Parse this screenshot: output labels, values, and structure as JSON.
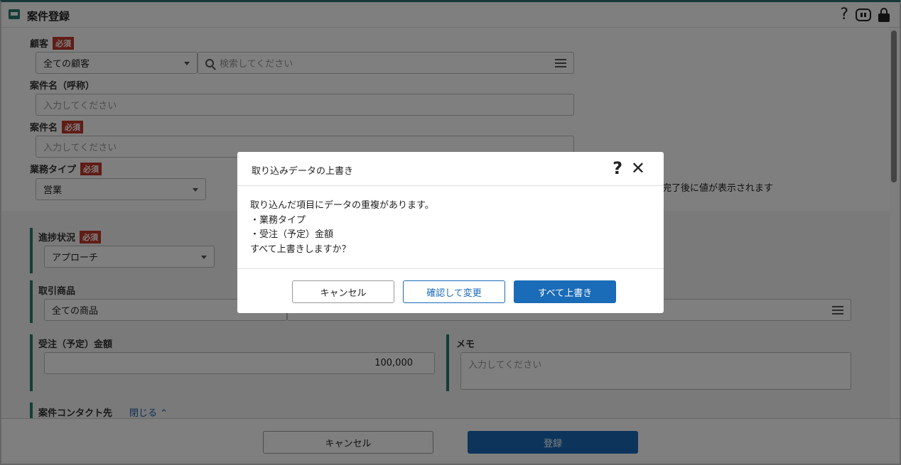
{
  "header": {
    "title": "案件登録"
  },
  "form": {
    "customer_label": "顧客",
    "required_badge": "必須",
    "customer_select": "全ての顧客",
    "customer_search_placeholder": "検索してください",
    "deal_nickname_label": "案件名（呼称）",
    "deal_nickname_placeholder": "入力してください",
    "deal_name_label": "案件名",
    "deal_name_placeholder": "入力してください",
    "business_type_label": "業務タイプ",
    "business_type_value": "営業",
    "hidden_note": "完了後に値が表示されます",
    "progress_label": "進捗状況",
    "progress_value": "アプローチ",
    "products_label": "取引商品",
    "products_value": "全ての商品",
    "amount_label": "受注（予定）金額",
    "amount_value": "100,000",
    "memo_label": "メモ",
    "memo_placeholder": "入力してください",
    "contacts_label": "案件コンタクト先",
    "contacts_toggle": "閉じる ⌃"
  },
  "footer": {
    "cancel_label": "キャンセル",
    "submit_label": "登録"
  },
  "modal": {
    "title": "取り込みデータの上書き",
    "help": "?",
    "close": "✕",
    "message": "取り込んだ項目にデータの重複があります。",
    "items": [
      "・業務タイプ",
      "・受注（予定）金額"
    ],
    "question": "すべて上書きしますか？",
    "cancel_label": "キャンセル",
    "review_label": "確認して変更",
    "overwrite_label": "すべて上書き"
  }
}
